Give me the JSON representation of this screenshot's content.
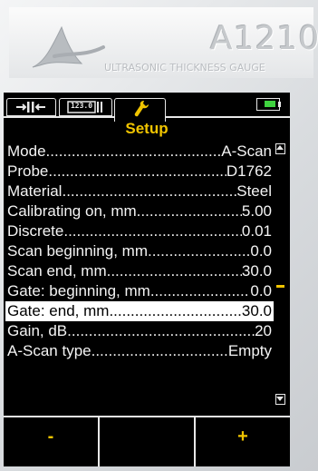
{
  "device": {
    "model": "A1210",
    "subtitle": "ULTRASONIC THICKNESS GAUGE",
    "logo_icon": "acs-logo-icon"
  },
  "tabs": [
    {
      "icon": "thickness-measure-icon"
    },
    {
      "icon": "numeric-display-icon",
      "text": "123.0"
    },
    {
      "icon": "wrench-icon",
      "active": true
    }
  ],
  "battery": {
    "icon": "battery-icon",
    "color": "#3fd23f"
  },
  "screen": {
    "title": "Setup",
    "menu": [
      {
        "label": "Mode",
        "value": "A-Scan"
      },
      {
        "label": "Probe",
        "value": "D1762"
      },
      {
        "label": "Material",
        "value": "Steel"
      },
      {
        "label": "Calibrating on, mm",
        "value": "5.00"
      },
      {
        "label": "Discrete",
        "value": "0.01"
      },
      {
        "label": "Scan beginning, mm",
        "value": "0.0"
      },
      {
        "label": "Scan end, mm",
        "value": "30.0"
      },
      {
        "label": "Gate: beginning, mm",
        "value": "0.0"
      },
      {
        "label": "Gate: end, mm",
        "value": "30.0",
        "selected": true
      },
      {
        "label": "Gain, dB",
        "value": "20"
      },
      {
        "label": "A-Scan type",
        "value": "Empty"
      }
    ],
    "scroll": {
      "position_fraction": 0.55
    }
  },
  "softkeys": {
    "left": "-",
    "middle": "",
    "right": "+"
  },
  "colors": {
    "accent": "#f0c400",
    "screen_bg": "#000000",
    "text": "#f4f4f4",
    "selected_bg": "#ffffff"
  }
}
